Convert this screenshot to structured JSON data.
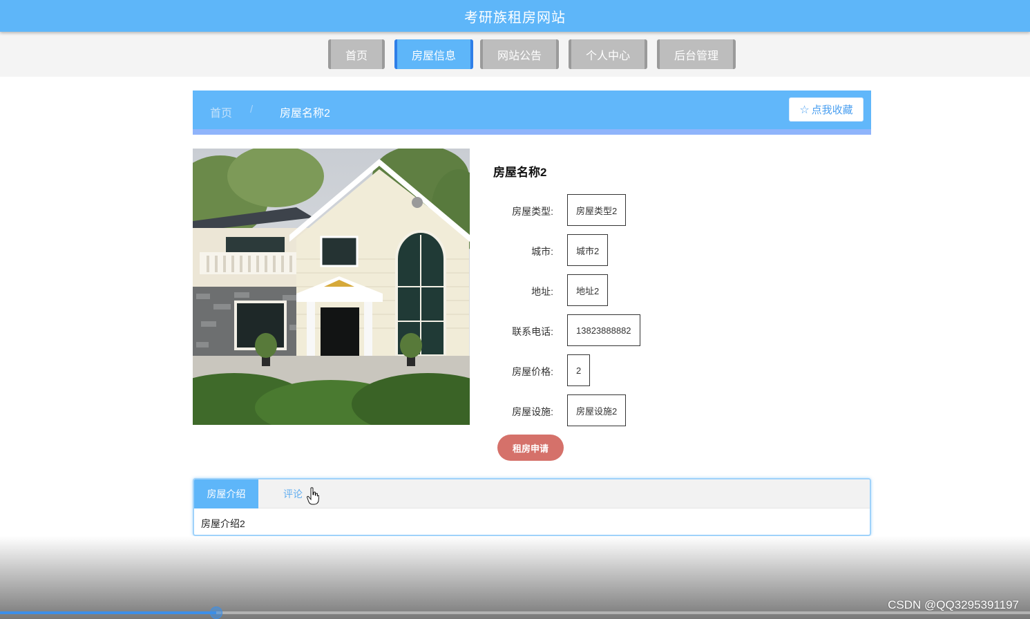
{
  "header": {
    "title": "考研族租房网站"
  },
  "nav": {
    "items": [
      {
        "label": "首页",
        "active": false
      },
      {
        "label": "房屋信息",
        "active": true
      },
      {
        "label": "网站公告",
        "active": false
      },
      {
        "label": "个人中心",
        "active": false
      },
      {
        "label": "后台管理",
        "active": false
      }
    ]
  },
  "breadcrumb": {
    "home": "首页",
    "separator": "/",
    "current": "房屋名称2"
  },
  "favorite": {
    "label": "点我收藏",
    "icon": "star-outline-icon"
  },
  "house": {
    "name": "房屋名称2",
    "fields": [
      {
        "label": "房屋类型:",
        "value": "房屋类型2"
      },
      {
        "label": "城市:",
        "value": "城市2"
      },
      {
        "label": "地址:",
        "value": "地址2"
      },
      {
        "label": "联系电话:",
        "value": "13823888882"
      },
      {
        "label": "房屋价格:",
        "value": "2"
      },
      {
        "label": "房屋设施:",
        "value": "房屋设施2"
      }
    ],
    "rent_button": "租房申请"
  },
  "tabs": {
    "items": [
      {
        "label": "房屋介绍",
        "active": true
      },
      {
        "label": "评论",
        "active": false
      }
    ],
    "content": "房屋介绍2"
  },
  "player": {
    "progress": 0.21
  },
  "watermark": "CSDN @QQ3295391197",
  "colors": {
    "primary": "#5eb6f9",
    "nav_inactive": "#bdbdbd",
    "rent_button": "#d5716a"
  }
}
